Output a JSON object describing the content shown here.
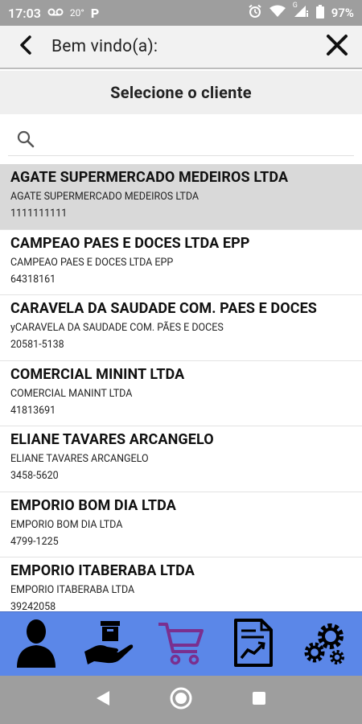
{
  "status_bar": {
    "time": "17:03",
    "temperature": "20°",
    "p_label": "P",
    "network_g": "G",
    "battery": "97%",
    "icons": [
      "voicemail-icon",
      "parking-icon",
      "alarm-icon",
      "wifi-icon",
      "signal-icon",
      "battery-icon"
    ]
  },
  "header": {
    "title": "Bem vindo(a):",
    "back_icon": "back-chevron-icon",
    "close_icon": "close-icon"
  },
  "subheader": {
    "title": "Selecione o cliente"
  },
  "search": {
    "value": "",
    "placeholder": "",
    "icon": "search-icon"
  },
  "clients": [
    {
      "name": "AGATE SUPERMERCADO MEDEIROS LTDA",
      "subtitle": "AGATE SUPERMERCADO MEDEIROS LTDA",
      "code": "1111111111",
      "selected": true
    },
    {
      "name": "CAMPEAO PAES E DOCES LTDA EPP",
      "subtitle": "CAMPEAO PAES E DOCES LTDA EPP",
      "code": "64318161",
      "selected": false
    },
    {
      "name": "CARAVELA DA SAUDADE COM. PAES E DOCES",
      "subtitle": "yCARAVELA DA SAUDADE COM. PÃES E DOCES",
      "code": "20581-5138",
      "selected": false
    },
    {
      "name": "COMERCIAL MININT LTDA",
      "subtitle": "COMERCIAL MANINT LTDA",
      "code": "41813691",
      "selected": false
    },
    {
      "name": "ELIANE TAVARES ARCANGELO",
      "subtitle": "ELIANE TAVARES ARCANGELO",
      "code": "3458-5620",
      "selected": false
    },
    {
      "name": "EMPORIO BOM DIA LTDA",
      "subtitle": "EMPORIO BOM DIA LTDA",
      "code": "4799-1225",
      "selected": false
    },
    {
      "name": "EMPORIO ITABERABA LTDA",
      "subtitle": "EMPORIO ITABERABA LTDA",
      "code": "39242058",
      "selected": false
    }
  ],
  "bottom_nav": {
    "background": "#5b87e8",
    "items": [
      {
        "icon": "user-icon"
      },
      {
        "icon": "delivery-box-hand-icon"
      },
      {
        "icon": "shopping-cart-icon"
      },
      {
        "icon": "report-chart-icon"
      },
      {
        "icon": "settings-gears-icon"
      }
    ]
  },
  "system_nav": {
    "items": [
      "back-triangle-icon",
      "home-circle-icon",
      "recents-square-icon"
    ]
  }
}
